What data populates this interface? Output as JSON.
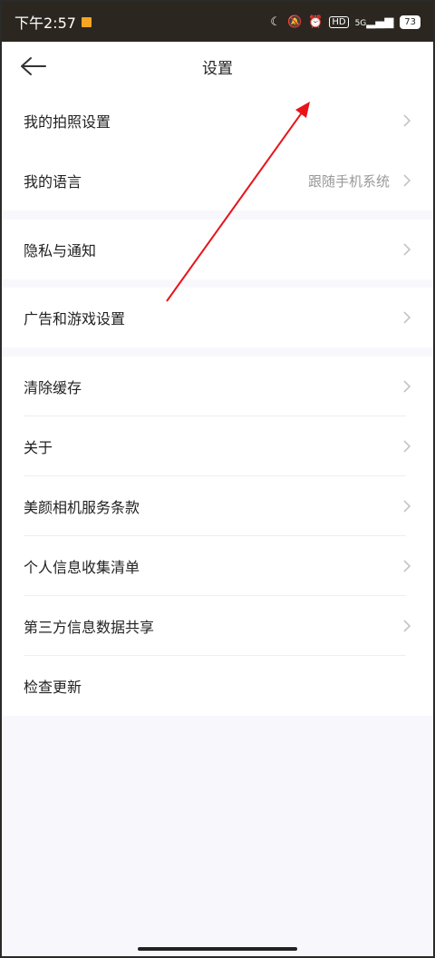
{
  "status_bar": {
    "time": "下午2:57",
    "signal_label": "5G",
    "battery": "73"
  },
  "header": {
    "title": "设置"
  },
  "groups": [
    {
      "items": [
        {
          "label": "我的拍照设置"
        },
        {
          "label": "我的语言",
          "value": "跟随手机系统"
        }
      ]
    },
    {
      "items": [
        {
          "label": "隐私与通知"
        }
      ]
    },
    {
      "items": [
        {
          "label": "广告和游戏设置"
        }
      ]
    },
    {
      "items": [
        {
          "label": "清除缓存"
        },
        {
          "label": "关于"
        },
        {
          "label": "美颜相机服务条款"
        },
        {
          "label": "个人信息收集清单"
        },
        {
          "label": "第三方信息数据共享"
        },
        {
          "label": "检查更新"
        }
      ]
    }
  ],
  "colors": {
    "annotation_arrow": "#e8141b",
    "status_bar_bg": "#2b2720",
    "page_bg": "#f8f7fc"
  }
}
